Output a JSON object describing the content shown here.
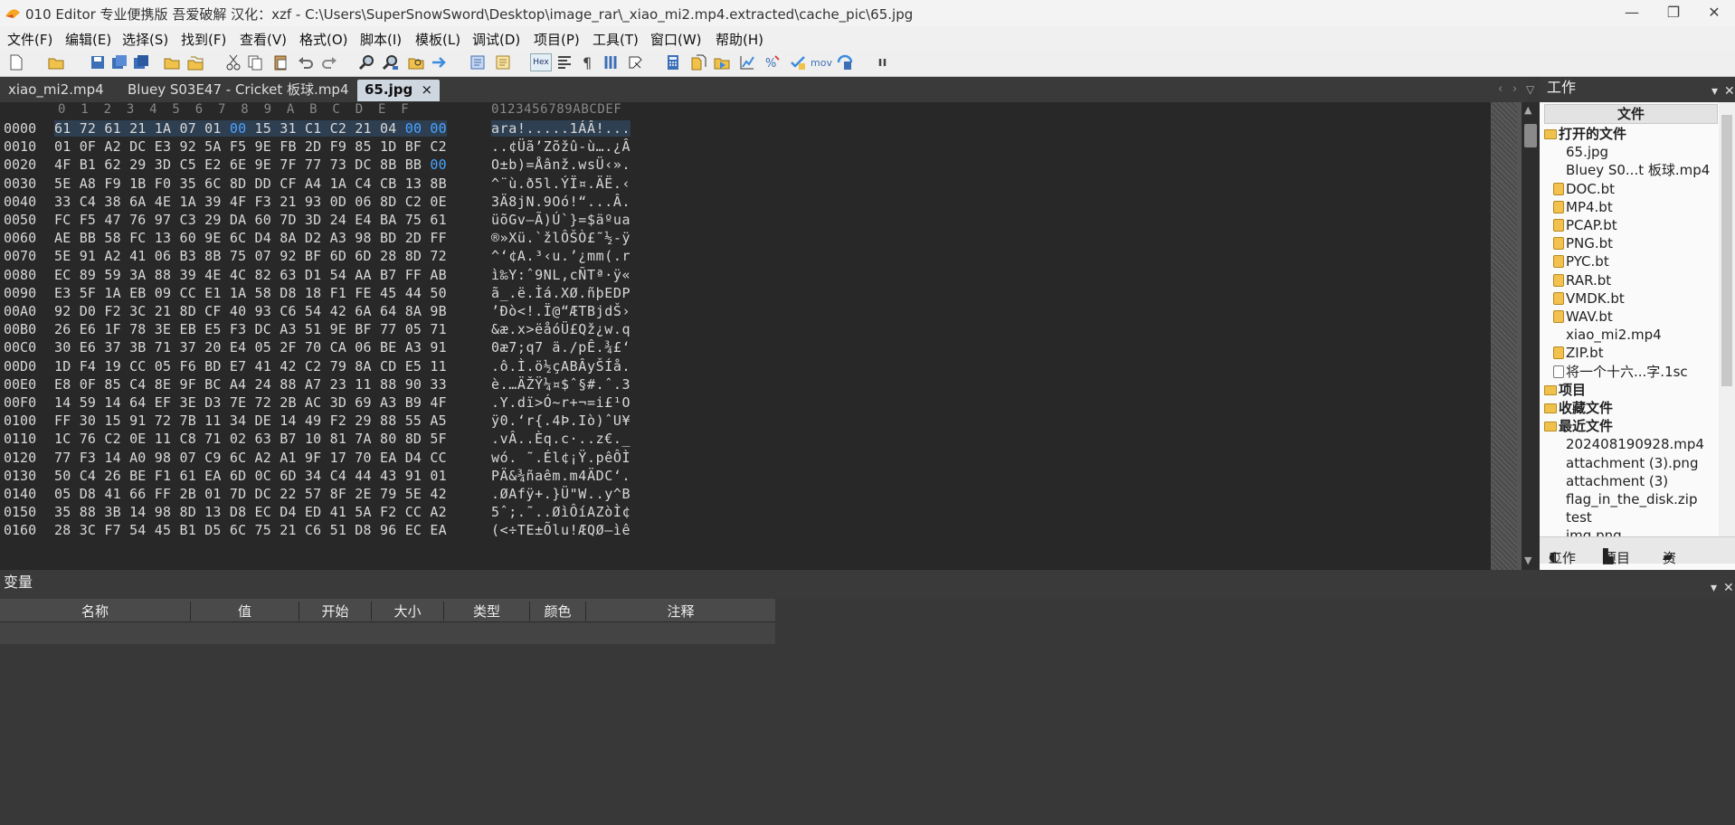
{
  "title_bar": {
    "text": "010 Editor 专业便携版 吾爱破解 汉化：xzf - C:\\Users\\SuperSnowSword\\Desktop\\image_rar\\_xiao_mi2.mp4.extracted\\cache_pic\\65.jpg",
    "minimize": "—",
    "maximize": "❐",
    "close": "✕"
  },
  "menu": [
    "文件(F)",
    "编辑(E)",
    "选择(S)",
    "找到(F)",
    "查看(V)",
    "格式(O)",
    "脚本(I)",
    "模板(L)",
    "调试(D)",
    "项目(P)",
    "工具(T)",
    "窗口(W)",
    "帮助(H)"
  ],
  "tabs": [
    {
      "label": "xiao_mi2.mp4"
    },
    {
      "label": "Bluey S03E47 - Cricket 板球.mp4"
    },
    {
      "label": "65.jpg"
    }
  ],
  "tab_close": "×",
  "hex_header": {
    "cols": "0  1  2  3  4  5  6  7  8  9  A  B  C  D  E  F",
    "ascii": "0123456789ABCDEF"
  },
  "hex_rows": [
    {
      "addr": "0000",
      "hex": "61 72 61 21 1A 07 01 00 15 31 C1 C2 21 04 00 00",
      "ascii": "ara!.....1ÁÂ!..."
    },
    {
      "addr": "0010",
      "hex": "01 0F A2 DC E3 92 5A F5 9E FB 2D F9 85 1D BF C2",
      "ascii": "..¢Üã’Zõžû-ù….¿Â"
    },
    {
      "addr": "0020",
      "hex": "4F B1 62 29 3D C5 E2 6E 9E 7F 77 73 DC 8B BB 00",
      "ascii": "O±b)=Åânž.wsÜ‹»."
    },
    {
      "addr": "0030",
      "hex": "5E A8 F9 1B F0 35 6C 8D DD CF A4 1A C4 CB 13 8B",
      "ascii": "^¨ù.ð5l.ÝÏ¤.ÄË.‹"
    },
    {
      "addr": "0040",
      "hex": "33 C4 38 6A 4E 1A 39 4F F3 21 93 0D 06 8D C2 0E",
      "ascii": "3Ä8jN.9Oó!“...Â."
    },
    {
      "addr": "0050",
      "hex": "FC F5 47 76 97 C3 29 DA 60 7D 3D 24 E4 BA 75 61",
      "ascii": "üõGv—Ã)Ú`}=$äºua"
    },
    {
      "addr": "0060",
      "hex": "AE BB 58 FC 13 60 9E 6C D4 8A D2 A3 98 BD 2D FF",
      "ascii": "®»Xü.`žlÔŠÒ£˜½-ÿ"
    },
    {
      "addr": "0070",
      "hex": "5E 91 A2 41 06 B3 8B 75 07 92 BF 6D 6D 28 8D 72",
      "ascii": "^‘¢A.³‹u.’¿mm(.r"
    },
    {
      "addr": "0080",
      "hex": "EC 89 59 3A 88 39 4E 4C 82 63 D1 54 AA B7 FF AB",
      "ascii": "ì‰Y:ˆ9NL‚cÑTª·ÿ«"
    },
    {
      "addr": "0090",
      "hex": "E3 5F 1A EB 09 CC E1 1A 58 D8 18 F1 FE 45 44 50",
      "ascii": "ã_.ë.Ìá.XØ.ñþEDP"
    },
    {
      "addr": "00A0",
      "hex": "92 D0 F2 3C 21 8D CF 40 93 C6 54 42 6A 64 8A 9B",
      "ascii": "’Ðò<!.Ï@“ÆTBjdŠ›"
    },
    {
      "addr": "00B0",
      "hex": "26 E6 1F 78 3E EB E5 F3 DC A3 51 9E BF 77 05 71",
      "ascii": "&æ.x>ëåóÜ£Qž¿w.q"
    },
    {
      "addr": "00C0",
      "hex": "30 E6 37 3B 71 37 20 E4 05 2F 70 CA 06 BE A3 91",
      "ascii": "0æ7;q7 ä./pÊ.¾£‘"
    },
    {
      "addr": "00D0",
      "hex": "1D F4 19 CC 05 F6 BD E7 41 42 C2 79 8A CD E5 11",
      "ascii": ".ô.Ì.ö½çABÂyŠÍå."
    },
    {
      "addr": "00E0",
      "hex": "E8 0F 85 C4 8E 9F BC A4 24 88 A7 23 11 88 90 33",
      "ascii": "è.…ÄŽŸ¼¤$ˆ§#.ˆ.3"
    },
    {
      "addr": "00F0",
      "hex": "14 59 14 64 EF 3E D3 7E 72 2B AC 3D 69 A3 B9 4F",
      "ascii": ".Y.dï>Ó~r+¬=i£¹O"
    },
    {
      "addr": "0100",
      "hex": "FF 30 15 91 72 7B 11 34 DE 14 49 F2 29 88 55 A5",
      "ascii": "ÿ0.‘r{.4Þ.Iò)ˆU¥"
    },
    {
      "addr": "0110",
      "hex": "1C 76 C2 0E 11 C8 71 02 63 B7 10 81 7A 80 8D 5F",
      "ascii": ".vÂ..Èq.c·..z€._"
    },
    {
      "addr": "0120",
      "hex": "77 F3 14 A0 98 07 C9 6C A2 A1 9F 17 70 EA D4 CC",
      "ascii": "wó. ˜.Él¢¡Ÿ.pêÔÌ"
    },
    {
      "addr": "0130",
      "hex": "50 C4 26 BE F1 61 EA 6D 0C 6D 34 C4 44 43 91 01",
      "ascii": "PÄ&¾ñaêm.m4ÄDC‘."
    },
    {
      "addr": "0140",
      "hex": "05 D8 41 66 FF 2B 01 7D DC 22 57 8F 2E 79 5E 42",
      "ascii": ".ØAfÿ+.}Ü\"W..y^B"
    },
    {
      "addr": "0150",
      "hex": "35 88 3B 14 98 8D 13 D8 EC D4 ED 41 5A F2 CC A2",
      "ascii": "5ˆ;.˜..ØìÔíAZòÌ¢"
    },
    {
      "addr": "0160",
      "hex": "28 3C F7 54 45 B1 D5 6C 75 21 C6 51 D8 96 EC EA",
      "ascii": "(<÷TE±Õlu!ÆQØ–ìê"
    }
  ],
  "right_panel": {
    "title": "工作",
    "header": "文件",
    "items": [
      {
        "label": "打开的文件",
        "kind": "folder"
      },
      {
        "label": "65.jpg",
        "kind": "file"
      },
      {
        "label": "Bluey S0...t 板球.mp4",
        "kind": "file"
      },
      {
        "label": "DOC.bt",
        "kind": "bt"
      },
      {
        "label": "MP4.bt",
        "kind": "bt"
      },
      {
        "label": "PCAP.bt",
        "kind": "bt"
      },
      {
        "label": "PNG.bt",
        "kind": "bt"
      },
      {
        "label": "PYC.bt",
        "kind": "bt"
      },
      {
        "label": "RAR.bt",
        "kind": "bt"
      },
      {
        "label": "VMDK.bt",
        "kind": "bt"
      },
      {
        "label": "WAV.bt",
        "kind": "bt"
      },
      {
        "label": "xiao_mi2.mp4",
        "kind": "file"
      },
      {
        "label": "ZIP.bt",
        "kind": "bt"
      },
      {
        "label": "将一个十六...字.1sc",
        "kind": "script"
      },
      {
        "label": "项目",
        "kind": "folder"
      },
      {
        "label": "收藏文件",
        "kind": "folder"
      },
      {
        "label": "最近文件",
        "kind": "folder"
      },
      {
        "label": "202408190928.mp4",
        "kind": "file"
      },
      {
        "label": "attachment (3).png",
        "kind": "file"
      },
      {
        "label": "attachment (3)",
        "kind": "file"
      },
      {
        "label": "flag_in_the_disk.zip",
        "kind": "file"
      },
      {
        "label": "test",
        "kind": "file"
      },
      {
        "label": "img.png",
        "kind": "file"
      }
    ],
    "bottom_tabs": [
      "工作",
      "项目",
      "资"
    ]
  },
  "variables_panel": {
    "title": "变量",
    "columns": [
      "名称",
      "值",
      "开始",
      "大小",
      "类型",
      "颜色",
      "注释"
    ]
  },
  "toolbar_icons": [
    "new-file-icon",
    "open-icon",
    "save-icon",
    "save-as-icon",
    "save-all-icon",
    "open-folder-icon",
    "copy-folder-icon",
    "cut-icon",
    "copy-icon",
    "paste-icon",
    "undo-icon",
    "redo-icon",
    "find-icon",
    "find-replace-icon",
    "find-in-files-icon",
    "goto-icon",
    "template-icon",
    "script-icon",
    "hex-icon",
    "edit-as-icon",
    "paragraph-icon",
    "columns-icon",
    "highlight-icon",
    "calculator-icon",
    "compare-icon",
    "run-icon",
    "histogram-icon",
    "percent-icon",
    "checksum-icon",
    "mov-label",
    "run-script-icon",
    "pause-icon"
  ],
  "mov_label": "mov",
  "hex_label": "Hex",
  "colors": {
    "highlight": "#2e3f52",
    "blue_bytes": "#4aa3ff",
    "bg": "#282828"
  }
}
